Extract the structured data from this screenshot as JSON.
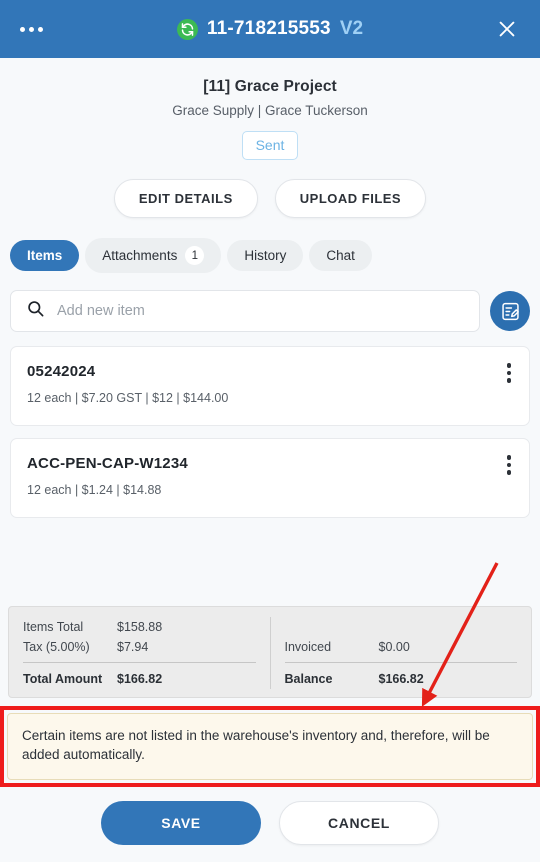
{
  "header": {
    "menu_icon": "more-horizontal-icon",
    "sync_icon": "sync-refresh-icon",
    "document_number": "11-718215553",
    "version": "V2",
    "close_icon": "close-icon",
    "background_color": "#3276b8",
    "sync_color": "#3cba54",
    "version_color": "#9fd0f5"
  },
  "summary": {
    "project_title": "[11] Grace Project",
    "supplier_contact": "Grace Supply | Grace Tuckerson",
    "status": "Sent",
    "status_color": "#6cb3e4"
  },
  "actions": {
    "edit_details": "EDIT DETAILS",
    "upload_files": "UPLOAD FILES"
  },
  "tabs": [
    {
      "label": "Items",
      "badge": null,
      "active": true
    },
    {
      "label": "Attachments",
      "badge": "1",
      "active": false
    },
    {
      "label": "History",
      "badge": null,
      "active": false
    },
    {
      "label": "Chat",
      "badge": null,
      "active": false
    }
  ],
  "search": {
    "icon": "search-icon",
    "value": "",
    "placeholder": "Add new item",
    "note_button_icon": "note-edit-icon"
  },
  "items": [
    {
      "name": "05242024",
      "meta": "12 each | $7.20 GST | $12 | $144.00",
      "menu_icon": "more-vertical-icon"
    },
    {
      "name": "ACC-PEN-CAP-W1234",
      "meta": "12 each | $1.24 | $14.88",
      "menu_icon": "more-vertical-icon"
    }
  ],
  "totals": {
    "items_total_label": "Items Total",
    "items_total_value": "$158.88",
    "tax_label": "Tax (5.00%)",
    "tax_value": "$7.94",
    "total_amount_label": "Total Amount",
    "total_amount_value": "$166.82",
    "invoiced_label": "Invoiced",
    "invoiced_value": "$0.00",
    "balance_label": "Balance",
    "balance_value": "$166.82"
  },
  "warning": {
    "message": "Certain items are not listed in the warehouse's inventory and, therefore, will be added automatically.",
    "border_color": "#ee1c1c",
    "background_color": "#fdf8ec"
  },
  "footer": {
    "save_label": "SAVE",
    "cancel_label": "CANCEL",
    "save_color": "#3276b8"
  }
}
